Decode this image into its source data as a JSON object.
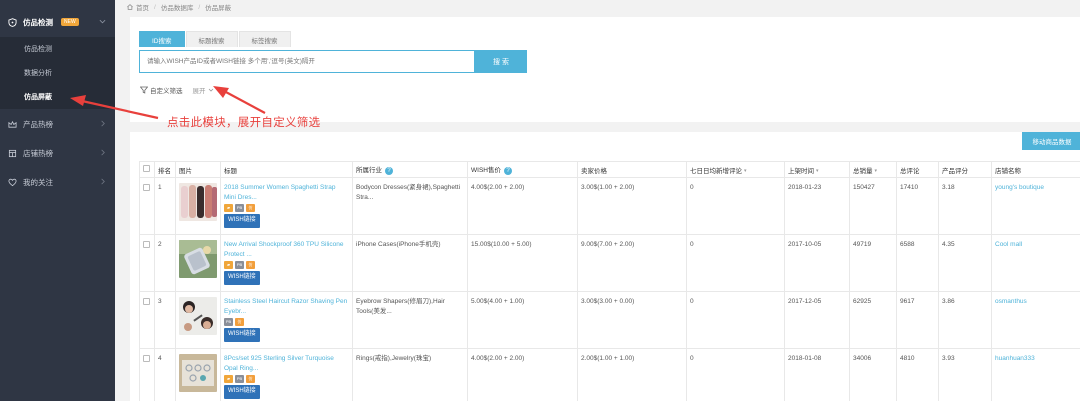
{
  "sidebar": {
    "items": [
      {
        "label": "仿品检测",
        "badge": "NEW",
        "active": true,
        "children": [
          {
            "label": "仿品检测"
          },
          {
            "label": "数据分析"
          },
          {
            "label": "仿品屏蔽",
            "active": true
          }
        ]
      },
      {
        "label": "产品热榜"
      },
      {
        "label": "店铺热榜"
      },
      {
        "label": "我的关注"
      }
    ]
  },
  "breadcrumb": [
    "首页",
    "仿品数据库",
    "仿品屏蔽"
  ],
  "search": {
    "tabs": [
      "ID搜索",
      "标题搜索",
      "标签搜索"
    ],
    "placeholder": "请输入WISH产品ID或者WISH链接 多个用','逗号(英文)隔开",
    "button": "搜 索"
  },
  "filter": {
    "custom_label": "自定义筛选",
    "expand_label": "展开"
  },
  "annotation": "点击此模块，展开自定义筛选",
  "toolbar": {
    "move_label": "移动商品数据"
  },
  "table": {
    "headers": [
      "排名",
      "图片",
      "标题",
      "所属行业",
      "WISH售价",
      "卖家价格",
      "七日日均新增评论",
      "上架时间",
      "总销量",
      "总评论",
      "产品评分",
      "店铺名称"
    ],
    "wish_link_label": "WISH链接",
    "rows": [
      {
        "rank": "1",
        "title": "2018 Summer Women Spaghetti Strap Mini Dres...",
        "industry": "Bodycon Dresses(紧身裙),Spaghetti Stra...",
        "wish_price": "4.00$(2.00 + 2.00)",
        "seller_price": "3.00$(1.00 + 2.00)",
        "daily_reviews": "0",
        "listed": "2018-01-23",
        "sales": "150427",
        "reviews": "17410",
        "rating": "3.18",
        "store": "young's boutique"
      },
      {
        "rank": "2",
        "title": "New Arrival Shockproof 360 TPU Silicone Protect ...",
        "industry": "iPhone Cases(iPhone手机壳)",
        "wish_price": "15.00$(10.00 + 5.00)",
        "seller_price": "9.00$(7.00 + 2.00)",
        "daily_reviews": "0",
        "listed": "2017-10-05",
        "sales": "49719",
        "reviews": "6588",
        "rating": "4.35",
        "store": "Cool mall"
      },
      {
        "rank": "3",
        "title": "Stainless Steel Haircut Razor Shaving Pen Eyebr...",
        "industry": "Eyebrow Shapers(修眉刀),Hair Tools(美发...",
        "wish_price": "5.00$(4.00 + 1.00)",
        "seller_price": "3.00$(3.00 + 0.00)",
        "daily_reviews": "0",
        "listed": "2017-12-05",
        "sales": "62925",
        "reviews": "9617",
        "rating": "3.86",
        "store": "osmanthus"
      },
      {
        "rank": "4",
        "title": "8Pcs/set 925 Sterling Silver Turquoise Opal Ring...",
        "industry": "Rings(戒指),Jewelry(珠宝)",
        "wish_price": "4.00$(2.00 + 2.00)",
        "seller_price": "2.00$(1.00 + 1.00)",
        "daily_reviews": "0",
        "listed": "2018-01-08",
        "sales": "34006",
        "reviews": "4810",
        "rating": "3.93",
        "store": "huanhuan333"
      }
    ]
  },
  "colors": {
    "accent": "#4fb3d9",
    "sidebar_bg": "#2f3644",
    "annotation": "#e8403c",
    "wish_button": "#2f72b8",
    "badge": "#f0a63a"
  }
}
